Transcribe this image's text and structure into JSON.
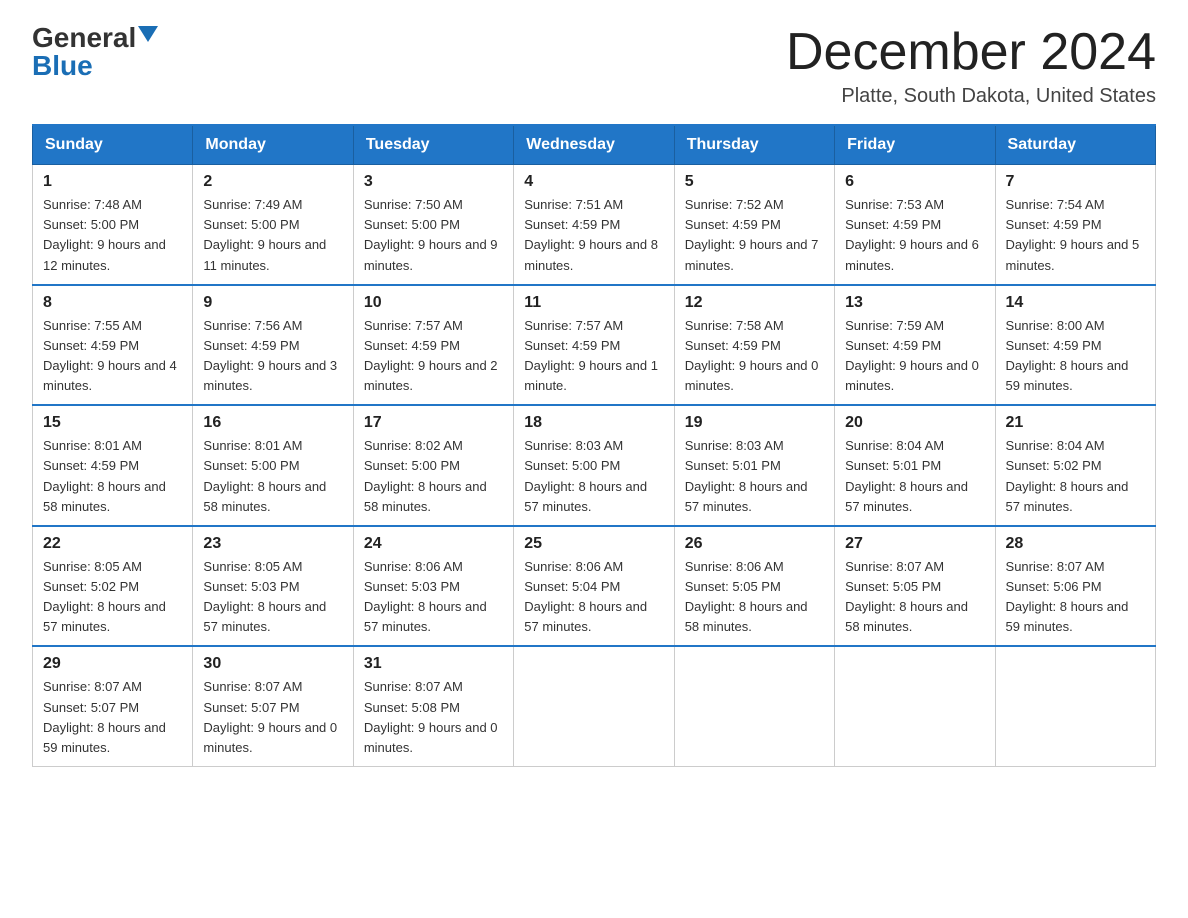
{
  "logo": {
    "general": "General",
    "blue": "Blue"
  },
  "title": {
    "month": "December 2024",
    "location": "Platte, South Dakota, United States"
  },
  "weekdays": [
    "Sunday",
    "Monday",
    "Tuesday",
    "Wednesday",
    "Thursday",
    "Friday",
    "Saturday"
  ],
  "weeks": [
    [
      {
        "day": "1",
        "sunrise": "7:48 AM",
        "sunset": "5:00 PM",
        "daylight": "9 hours and 12 minutes."
      },
      {
        "day": "2",
        "sunrise": "7:49 AM",
        "sunset": "5:00 PM",
        "daylight": "9 hours and 11 minutes."
      },
      {
        "day": "3",
        "sunrise": "7:50 AM",
        "sunset": "5:00 PM",
        "daylight": "9 hours and 9 minutes."
      },
      {
        "day": "4",
        "sunrise": "7:51 AM",
        "sunset": "4:59 PM",
        "daylight": "9 hours and 8 minutes."
      },
      {
        "day": "5",
        "sunrise": "7:52 AM",
        "sunset": "4:59 PM",
        "daylight": "9 hours and 7 minutes."
      },
      {
        "day": "6",
        "sunrise": "7:53 AM",
        "sunset": "4:59 PM",
        "daylight": "9 hours and 6 minutes."
      },
      {
        "day": "7",
        "sunrise": "7:54 AM",
        "sunset": "4:59 PM",
        "daylight": "9 hours and 5 minutes."
      }
    ],
    [
      {
        "day": "8",
        "sunrise": "7:55 AM",
        "sunset": "4:59 PM",
        "daylight": "9 hours and 4 minutes."
      },
      {
        "day": "9",
        "sunrise": "7:56 AM",
        "sunset": "4:59 PM",
        "daylight": "9 hours and 3 minutes."
      },
      {
        "day": "10",
        "sunrise": "7:57 AM",
        "sunset": "4:59 PM",
        "daylight": "9 hours and 2 minutes."
      },
      {
        "day": "11",
        "sunrise": "7:57 AM",
        "sunset": "4:59 PM",
        "daylight": "9 hours and 1 minute."
      },
      {
        "day": "12",
        "sunrise": "7:58 AM",
        "sunset": "4:59 PM",
        "daylight": "9 hours and 0 minutes."
      },
      {
        "day": "13",
        "sunrise": "7:59 AM",
        "sunset": "4:59 PM",
        "daylight": "9 hours and 0 minutes."
      },
      {
        "day": "14",
        "sunrise": "8:00 AM",
        "sunset": "4:59 PM",
        "daylight": "8 hours and 59 minutes."
      }
    ],
    [
      {
        "day": "15",
        "sunrise": "8:01 AM",
        "sunset": "4:59 PM",
        "daylight": "8 hours and 58 minutes."
      },
      {
        "day": "16",
        "sunrise": "8:01 AM",
        "sunset": "5:00 PM",
        "daylight": "8 hours and 58 minutes."
      },
      {
        "day": "17",
        "sunrise": "8:02 AM",
        "sunset": "5:00 PM",
        "daylight": "8 hours and 58 minutes."
      },
      {
        "day": "18",
        "sunrise": "8:03 AM",
        "sunset": "5:00 PM",
        "daylight": "8 hours and 57 minutes."
      },
      {
        "day": "19",
        "sunrise": "8:03 AM",
        "sunset": "5:01 PM",
        "daylight": "8 hours and 57 minutes."
      },
      {
        "day": "20",
        "sunrise": "8:04 AM",
        "sunset": "5:01 PM",
        "daylight": "8 hours and 57 minutes."
      },
      {
        "day": "21",
        "sunrise": "8:04 AM",
        "sunset": "5:02 PM",
        "daylight": "8 hours and 57 minutes."
      }
    ],
    [
      {
        "day": "22",
        "sunrise": "8:05 AM",
        "sunset": "5:02 PM",
        "daylight": "8 hours and 57 minutes."
      },
      {
        "day": "23",
        "sunrise": "8:05 AM",
        "sunset": "5:03 PM",
        "daylight": "8 hours and 57 minutes."
      },
      {
        "day": "24",
        "sunrise": "8:06 AM",
        "sunset": "5:03 PM",
        "daylight": "8 hours and 57 minutes."
      },
      {
        "day": "25",
        "sunrise": "8:06 AM",
        "sunset": "5:04 PM",
        "daylight": "8 hours and 57 minutes."
      },
      {
        "day": "26",
        "sunrise": "8:06 AM",
        "sunset": "5:05 PM",
        "daylight": "8 hours and 58 minutes."
      },
      {
        "day": "27",
        "sunrise": "8:07 AM",
        "sunset": "5:05 PM",
        "daylight": "8 hours and 58 minutes."
      },
      {
        "day": "28",
        "sunrise": "8:07 AM",
        "sunset": "5:06 PM",
        "daylight": "8 hours and 59 minutes."
      }
    ],
    [
      {
        "day": "29",
        "sunrise": "8:07 AM",
        "sunset": "5:07 PM",
        "daylight": "8 hours and 59 minutes."
      },
      {
        "day": "30",
        "sunrise": "8:07 AM",
        "sunset": "5:07 PM",
        "daylight": "9 hours and 0 minutes."
      },
      {
        "day": "31",
        "sunrise": "8:07 AM",
        "sunset": "5:08 PM",
        "daylight": "9 hours and 0 minutes."
      },
      null,
      null,
      null,
      null
    ]
  ],
  "labels": {
    "sunrise": "Sunrise:",
    "sunset": "Sunset:",
    "daylight": "Daylight:"
  }
}
